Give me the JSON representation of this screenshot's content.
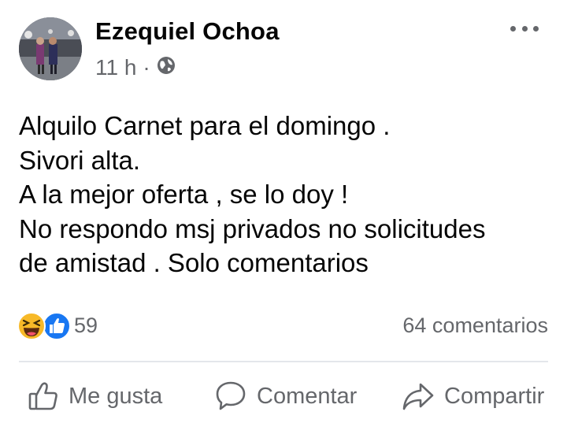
{
  "post": {
    "author": "Ezequiel Ochoa",
    "time": "11 h",
    "separator": "·",
    "privacy_icon": "globe-icon",
    "menu_icon": "more-options-icon",
    "lines": [
      "Alquilo Carnet para el domingo .",
      "Sivori alta.",
      "A la mejor oferta , se lo doy !",
      "No respondo msj privados no solicitudes",
      "de amistad . Solo comentarios"
    ]
  },
  "reactions": {
    "icons": [
      "haha-icon",
      "like-icon"
    ],
    "count": "59",
    "comments": "64 comentarios"
  },
  "actions": {
    "like": "Me gusta",
    "comment": "Comentar",
    "share": "Compartir"
  },
  "colors": {
    "like_blue": "#1877f2",
    "haha_yellow": "#f7b928",
    "secondary_text": "#65676b"
  }
}
